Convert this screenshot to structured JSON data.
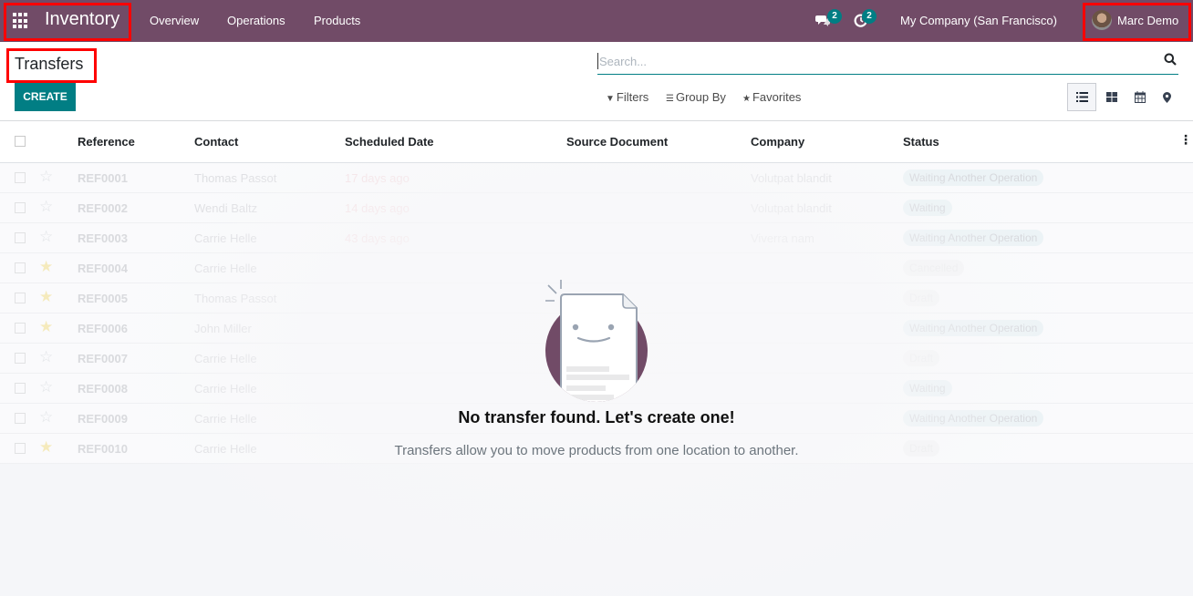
{
  "navbar": {
    "app_name": "Inventory",
    "menu": [
      "Overview",
      "Operations",
      "Products"
    ],
    "messages_icon": "chat-icon",
    "messages_count": "2",
    "activities_icon": "clock-icon",
    "activities_count": "2",
    "company": "My Company (San Francisco)",
    "user": "Marc Demo",
    "color": "#714B67"
  },
  "control_panel": {
    "title": "Transfers",
    "create_label": "CREATE",
    "search_placeholder": "Search...",
    "filters_label": "Filters",
    "groupby_label": "Group By",
    "favorites_label": "Favorites",
    "views": [
      "list-view",
      "kanban-view",
      "calendar-view",
      "map-view"
    ],
    "accent": "#017E84"
  },
  "list": {
    "columns": [
      "Reference",
      "Contact",
      "Scheduled Date",
      "Source Document",
      "Company",
      "Status"
    ],
    "rows": [
      {
        "ref": "REF0001",
        "contact": "Thomas Passot",
        "date": "17 days ago",
        "source": "",
        "company": "Volutpat blandit",
        "status": "Waiting Another Operation",
        "starred": false
      },
      {
        "ref": "REF0002",
        "contact": "Wendi Baltz",
        "date": "14 days ago",
        "source": "",
        "company": "Volutpat blandit",
        "status": "Waiting",
        "starred": false
      },
      {
        "ref": "REF0003",
        "contact": "Carrie Helle",
        "date": "43 days ago",
        "source": "",
        "company": "Viverra nam",
        "status": "Waiting Another Operation",
        "starred": false
      },
      {
        "ref": "REF0004",
        "contact": "Carrie Helle",
        "date": "",
        "source": "",
        "company": "",
        "status": "Cancelled",
        "starred": true
      },
      {
        "ref": "REF0005",
        "contact": "Thomas Passot",
        "date": "",
        "source": "",
        "company": "",
        "status": "Draft",
        "starred": true
      },
      {
        "ref": "REF0006",
        "contact": "John Miller",
        "date": "",
        "source": "",
        "company": "",
        "status": "Waiting Another Operation",
        "starred": true
      },
      {
        "ref": "REF0007",
        "contact": "Carrie Helle",
        "date": "",
        "source": "",
        "company": "",
        "status": "Draft",
        "starred": false
      },
      {
        "ref": "REF0008",
        "contact": "Carrie Helle",
        "date": "",
        "source": "",
        "company": "",
        "status": "Waiting",
        "starred": false
      },
      {
        "ref": "REF0009",
        "contact": "Carrie Helle",
        "date": "",
        "source": "",
        "company": "",
        "status": "Waiting Another Operation",
        "starred": false
      },
      {
        "ref": "REF0010",
        "contact": "Carrie Helle",
        "date": "",
        "source": "",
        "company": "",
        "status": "Draft",
        "starred": true
      }
    ]
  },
  "helper": {
    "title": "No transfer found. Let's create one!",
    "text": "Transfers allow you to move products from one location to another."
  }
}
